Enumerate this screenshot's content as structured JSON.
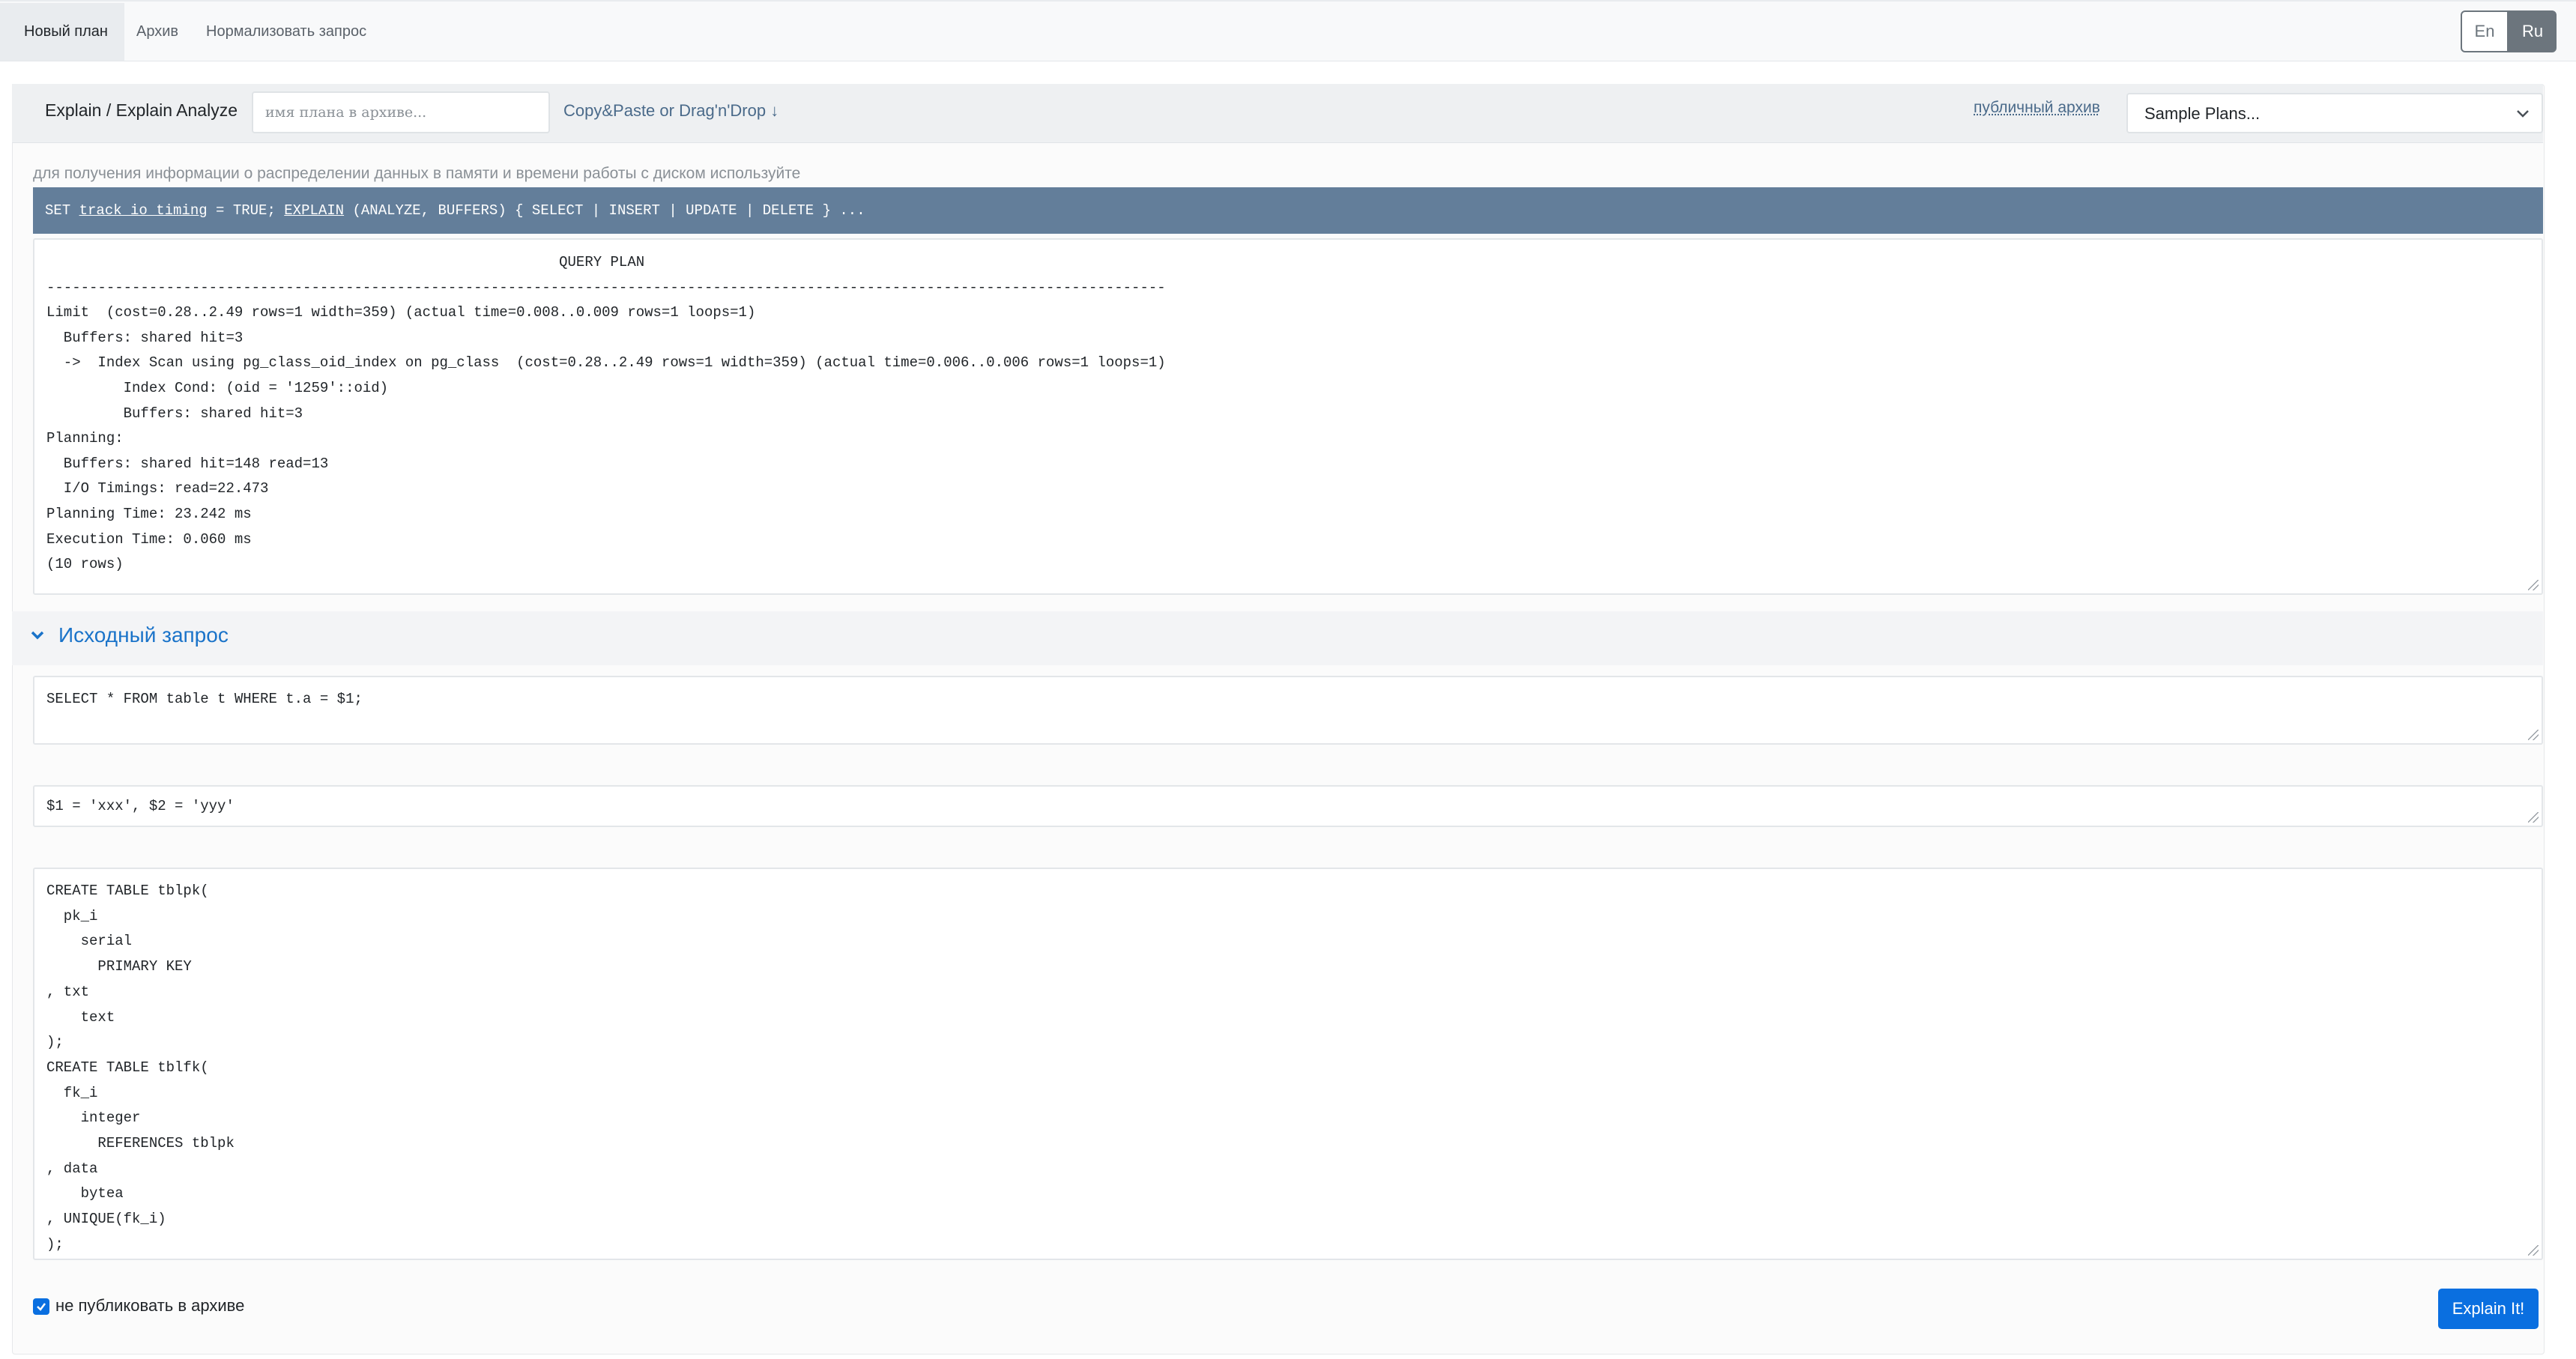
{
  "nav": {
    "tabs": [
      {
        "label": "Новый план",
        "active": true
      },
      {
        "label": "Архив",
        "active": false
      },
      {
        "label": "Нормализовать запрос",
        "active": false
      }
    ],
    "languages": [
      {
        "label": "En",
        "active": false
      },
      {
        "label": "Ru",
        "active": true
      }
    ]
  },
  "toolbar": {
    "title": "Explain / Explain Analyze",
    "plan_name_placeholder": "имя плана в архиве...",
    "paste_hint": "Copy&Paste or Drag'n'Drop ↓",
    "public_archive_link": "публичный архив",
    "sample_plans_selected": "Sample Plans..."
  },
  "hint_text": "для получения информации о распределении данных в памяти и времени работы с диском используйте",
  "command": {
    "part1": "SET ",
    "track": "track_io_timing",
    "part2": " = TRUE; ",
    "explain": "EXPLAIN",
    "part3": " (ANALYZE, BUFFERS) { SELECT | INSERT | UPDATE | DELETE } ..."
  },
  "plan_text": "                                                            QUERY PLAN\n-----------------------------------------------------------------------------------------------------------------------------------\nLimit  (cost=0.28..2.49 rows=1 width=359) (actual time=0.008..0.009 rows=1 loops=1)\n  Buffers: shared hit=3\n  ->  Index Scan using pg_class_oid_index on pg_class  (cost=0.28..2.49 rows=1 width=359) (actual time=0.006..0.006 rows=1 loops=1)\n         Index Cond: (oid = '1259'::oid)\n         Buffers: shared hit=3\nPlanning:\n  Buffers: shared hit=148 read=13\n  I/O Timings: read=22.473\nPlanning Time: 23.242 ms\nExecution Time: 0.060 ms\n(10 rows)",
  "source_section": {
    "title": "Исходный запрос",
    "query": "SELECT * FROM table t WHERE t.a = $1;",
    "params": "$1 = 'xxx', $2 = 'yyy'",
    "ddl": "CREATE TABLE tblpk(\n  pk_i\n    serial\n      PRIMARY KEY\n, txt\n    text\n);\nCREATE TABLE tblfk(\n  fk_i\n    integer\n      REFERENCES tblpk\n, data\n    bytea\n, UNIQUE(fk_i)\n);"
  },
  "footer": {
    "checkbox_label": "не публиковать в архиве",
    "checkbox_checked": true,
    "submit_label": "Explain It!"
  },
  "colors": {
    "accent": "#0a6fe0",
    "command_bar": "#637e9a",
    "link": "#4a6a8a"
  }
}
